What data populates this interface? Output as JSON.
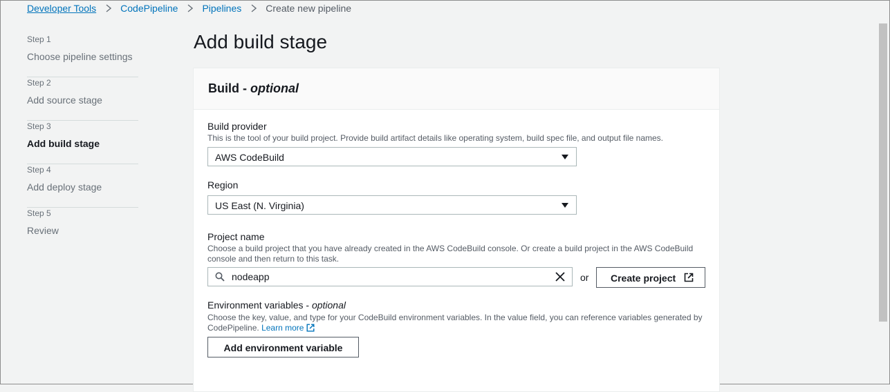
{
  "breadcrumb": {
    "items": [
      "Developer Tools",
      "CodePipeline",
      "Pipelines"
    ],
    "current": "Create new pipeline"
  },
  "steps": [
    {
      "num": "Step 1",
      "title": "Choose pipeline settings"
    },
    {
      "num": "Step 2",
      "title": "Add source stage"
    },
    {
      "num": "Step 3",
      "title": "Add build stage"
    },
    {
      "num": "Step 4",
      "title": "Add deploy stage"
    },
    {
      "num": "Step 5",
      "title": "Review"
    }
  ],
  "page_title": "Add build stage",
  "panel": {
    "title": "Build - ",
    "title_optional": "optional"
  },
  "build_provider": {
    "label": "Build provider",
    "description": "This is the tool of your build project. Provide build artifact details like operating system, build spec file, and output file names.",
    "value": "AWS CodeBuild"
  },
  "region": {
    "label": "Region",
    "value": "US East (N. Virginia)"
  },
  "project_name": {
    "label": "Project name",
    "description": "Choose a build project that you have already created in the AWS CodeBuild console. Or create a build project in the AWS CodeBuild console and then return to this task.",
    "value": "nodeapp",
    "or_text": "or",
    "create_button": "Create project"
  },
  "env_vars": {
    "label": "Environment variables - ",
    "label_optional": "optional",
    "description": "Choose the key, value, and type for your CodeBuild environment variables. In the value field, you can reference variables generated by CodePipeline.",
    "learn_more": "Learn more",
    "add_button": "Add environment variable"
  },
  "icons": {
    "breadcrumb_separator": "chevron-right-icon",
    "select_caret": "caret-down-icon",
    "search": "search-icon",
    "clear": "close-icon",
    "external_link": "external-link-icon"
  },
  "colors": {
    "link": "#0073bb",
    "background": "#f2f3f3",
    "text": "#16191f",
    "muted": "#687078"
  }
}
